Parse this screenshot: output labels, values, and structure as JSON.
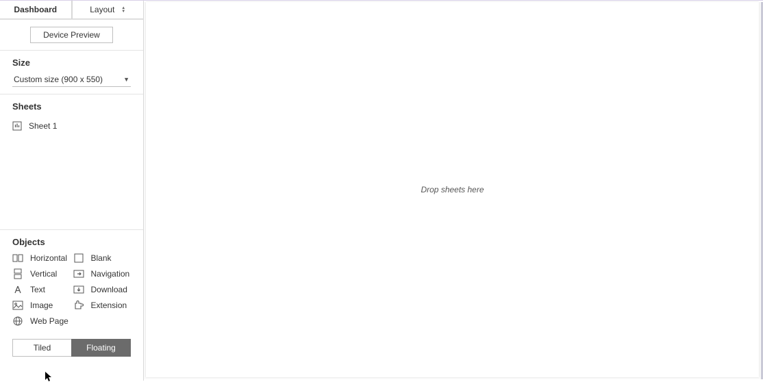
{
  "tabs": {
    "dashboard": "Dashboard",
    "layout": "Layout"
  },
  "device_preview": "Device Preview",
  "size": {
    "title": "Size",
    "value": "Custom size (900 x 550)"
  },
  "sheets": {
    "title": "Sheets",
    "items": [
      "Sheet 1"
    ]
  },
  "objects": {
    "title": "Objects",
    "horizontal": "Horizontal",
    "blank": "Blank",
    "vertical": "Vertical",
    "navigation": "Navigation",
    "text": "Text",
    "download": "Download",
    "image": "Image",
    "extension": "Extension",
    "webpage": "Web Page"
  },
  "mode": {
    "tiled": "Tiled",
    "floating": "Floating"
  },
  "canvas": {
    "drop_hint": "Drop sheets here"
  }
}
